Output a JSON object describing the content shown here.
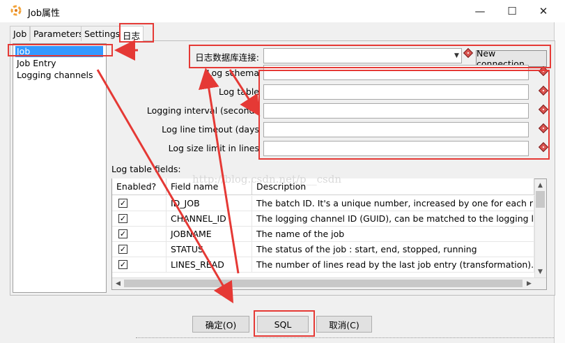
{
  "window": {
    "title": "Job属性",
    "minimize_glyph": "—",
    "maximize_glyph": "☐",
    "close_glyph": "✕"
  },
  "tabs": [
    {
      "label": "Job"
    },
    {
      "label": "Parameters"
    },
    {
      "label": "Settings"
    },
    {
      "label": "日志"
    }
  ],
  "left_list": [
    {
      "label": "Job"
    },
    {
      "label": "Job Entry"
    },
    {
      "label": "Logging channels"
    }
  ],
  "form": {
    "connection_label": "日志数据库连接:",
    "connection_value": "",
    "new_connection_label": "New connection",
    "log_schema_label": "Log schema",
    "log_table_label": "Log table",
    "logging_interval_label": "Logging interval (seconds",
    "log_line_timeout_label": "Log line timeout (days",
    "log_size_limit_label": "Log size limit in lines"
  },
  "table": {
    "caption": "Log table fields:",
    "columns": [
      "Enabled?",
      "Field name",
      "Description"
    ],
    "rows": [
      {
        "enabled": true,
        "field": "ID_JOB",
        "description": "The batch ID. It's a unique number, increased by one for each run of"
      },
      {
        "enabled": true,
        "field": "CHANNEL_ID",
        "description": "The logging channel ID (GUID), can be matched to the logging lineag"
      },
      {
        "enabled": true,
        "field": "JOBNAME",
        "description": "The name of the job"
      },
      {
        "enabled": true,
        "field": "STATUS",
        "description": "The status of the job : start, end, stopped, running"
      },
      {
        "enabled": true,
        "field": "LINES_READ",
        "description": "The number of lines read by the last job entry (transformation)."
      }
    ]
  },
  "buttons": {
    "ok": "确定(O)",
    "sql": "SQL",
    "cancel": "取消(C)"
  },
  "watermark": "http://blog.csdn.net/p__csdn",
  "colors": {
    "selection": "#3399ff",
    "annotation_red": "#e53935",
    "required_marker": "#d9534f"
  }
}
